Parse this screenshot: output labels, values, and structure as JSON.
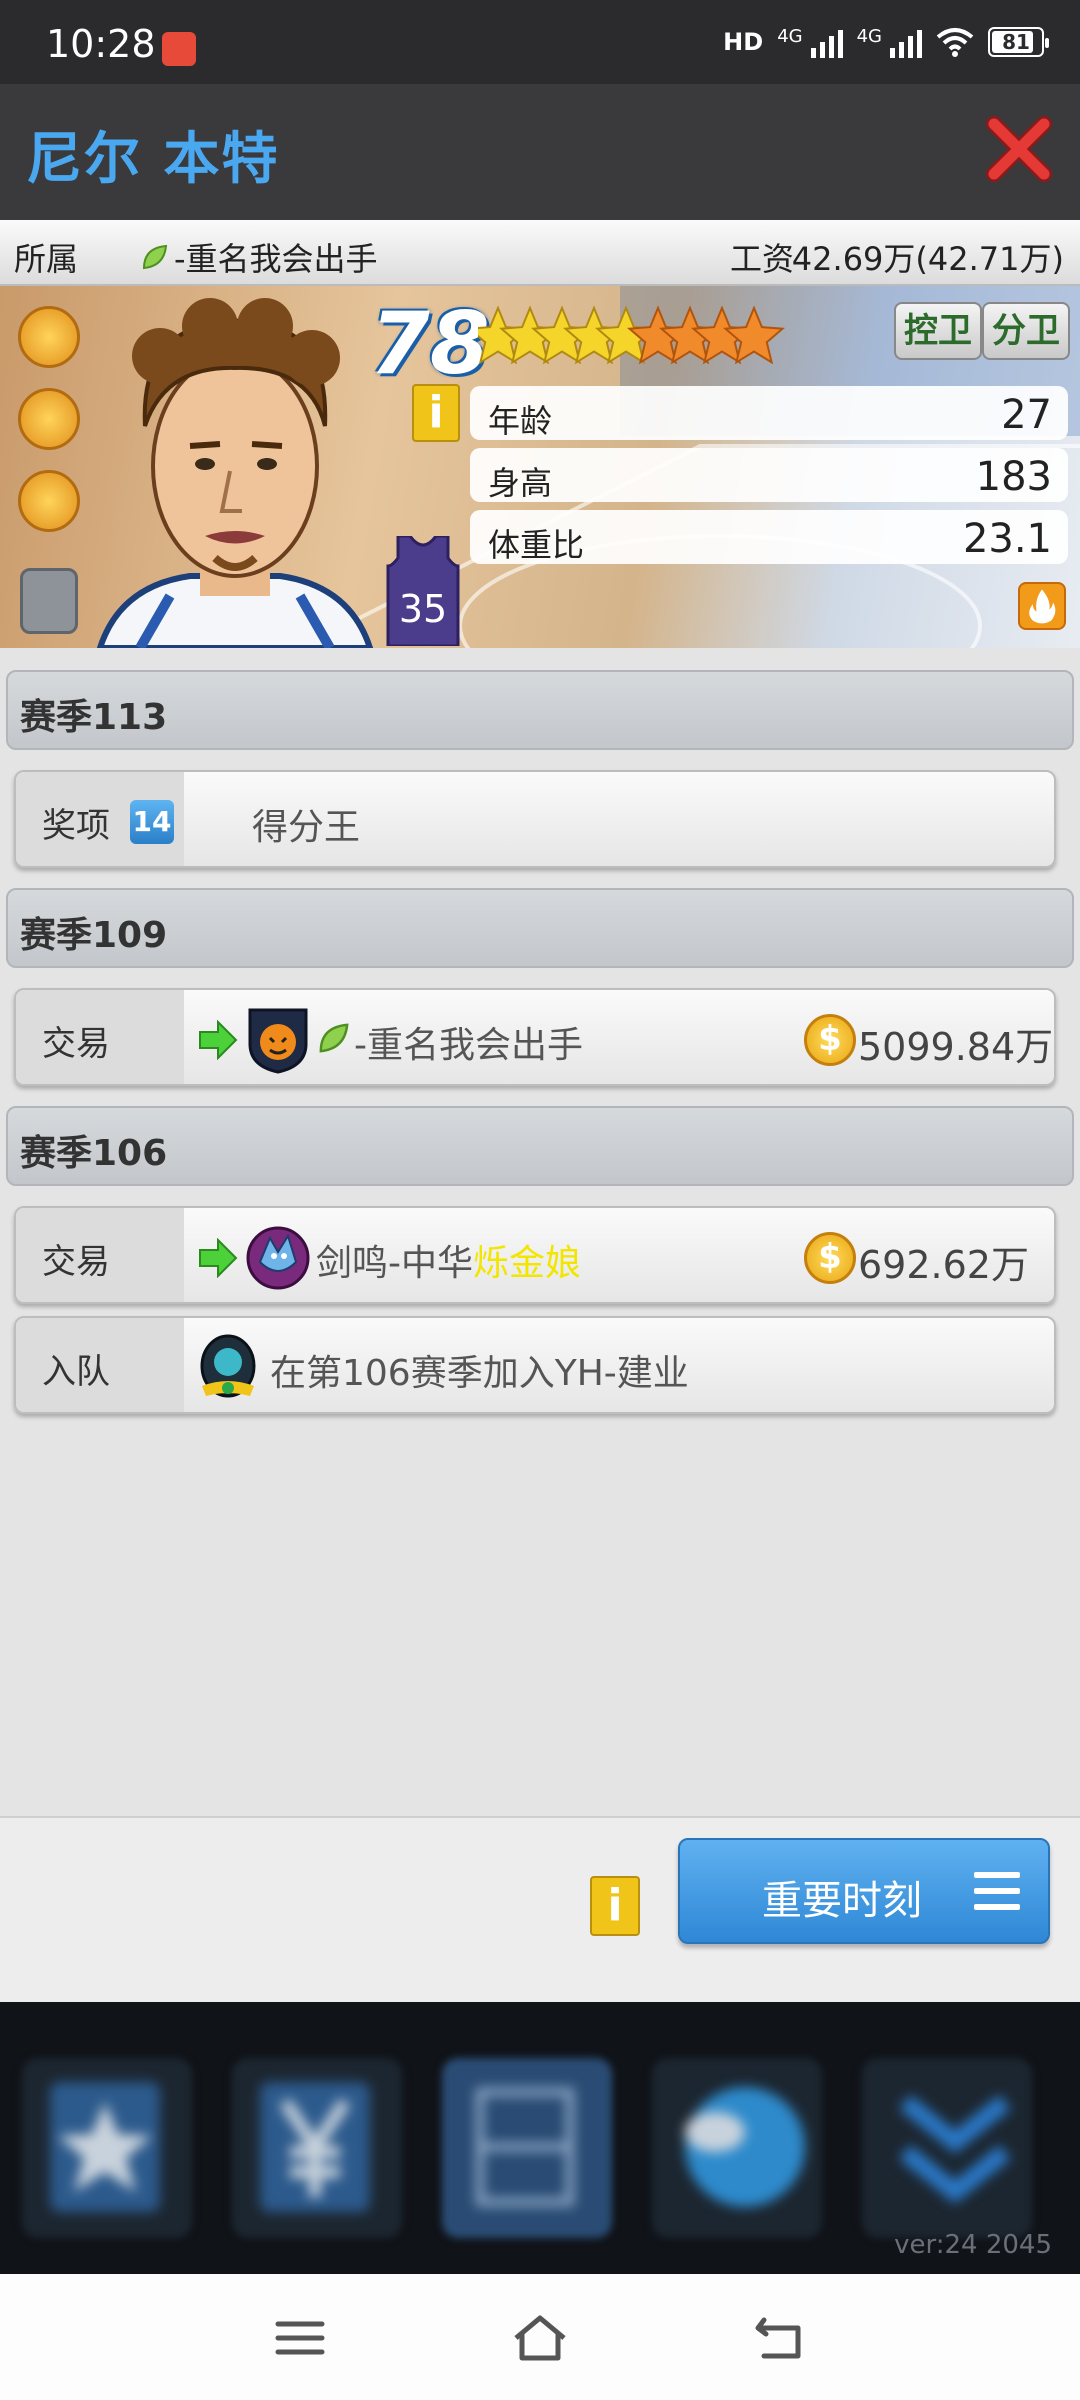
{
  "status_bar": {
    "time": "10:28",
    "hd_label": "HD",
    "network_1": "4G",
    "network_2": "4G",
    "battery": "81"
  },
  "header": {
    "player_name": "尼尔 本特"
  },
  "info": {
    "team_label": "所属",
    "team_name": "-重名我会出手",
    "salary_label": "工资",
    "salary_value": "42.69万(42.71万)"
  },
  "player": {
    "rating": "78",
    "stars_total": 9,
    "positions": [
      "控卫",
      "分卫"
    ],
    "jersey_number": "35",
    "info_icon": "i",
    "stats": [
      {
        "label": "年龄",
        "value": "27"
      },
      {
        "label": "身高",
        "value": "183"
      },
      {
        "label": "体重比",
        "value": "23.1"
      }
    ]
  },
  "history": {
    "season_113": {
      "title": "赛季113",
      "award_label": "奖项",
      "award_badge": "14",
      "award_name": "得分王"
    },
    "season_109": {
      "title": "赛季109",
      "trade_label": "交易",
      "trade_team": "-重名我会出手",
      "trade_amount": "5099.84万"
    },
    "season_106": {
      "title": "赛季106",
      "trade_label": "交易",
      "trade_team_prefix": "剑鸣-中华",
      "trade_team_highlight": "烁金娘",
      "trade_amount": "692.62万",
      "join_label": "入队",
      "join_text": "在第106赛季加入YH-建业"
    }
  },
  "footer": {
    "info_icon": "i",
    "moments_button": "重要时刻"
  },
  "version": "ver:24  2045",
  "colors": {
    "name_blue": "#4aa8f0",
    "button_blue": "#3d95de",
    "highlight_yellow": "#f2e600",
    "close_red": "#e53935"
  },
  "icons": {
    "close": "close-icon",
    "coin": "coin-icon",
    "arrow": "arrow-right-icon",
    "menu": "menu-icon"
  }
}
